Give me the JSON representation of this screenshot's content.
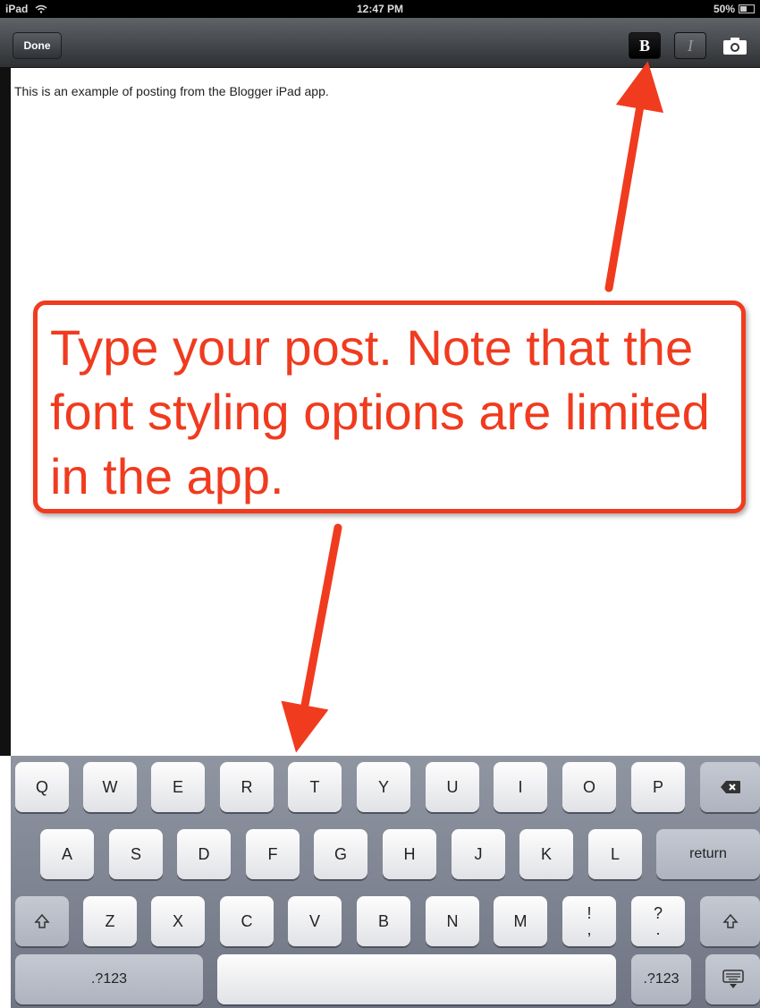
{
  "status_bar": {
    "device": "iPad",
    "time": "12:47 PM",
    "battery": "50%",
    "battery_level": 0.5
  },
  "toolbar": {
    "done_label": "Done",
    "bold_label": "B",
    "italic_label": "I",
    "camera_icon": "camera-icon"
  },
  "post": {
    "body": "This is an example of posting from the Blogger iPad app."
  },
  "annotation": {
    "text": "Type your post. Note that the font styling options are limited in the app.",
    "color": "#f03b1f"
  },
  "keyboard": {
    "row1": [
      "Q",
      "W",
      "E",
      "R",
      "T",
      "Y",
      "U",
      "I",
      "O",
      "P"
    ],
    "row2": [
      "A",
      "S",
      "D",
      "F",
      "G",
      "H",
      "J",
      "K",
      "L"
    ],
    "row3": [
      "Z",
      "X",
      "C",
      "V",
      "B",
      "N",
      "M"
    ],
    "return_label": "return",
    "numbers_left_label": ".?123",
    "numbers_right_label": ".?123",
    "punct1_top": "!",
    "punct1_bottom": ",",
    "punct2_top": "?",
    "punct2_bottom": "."
  }
}
